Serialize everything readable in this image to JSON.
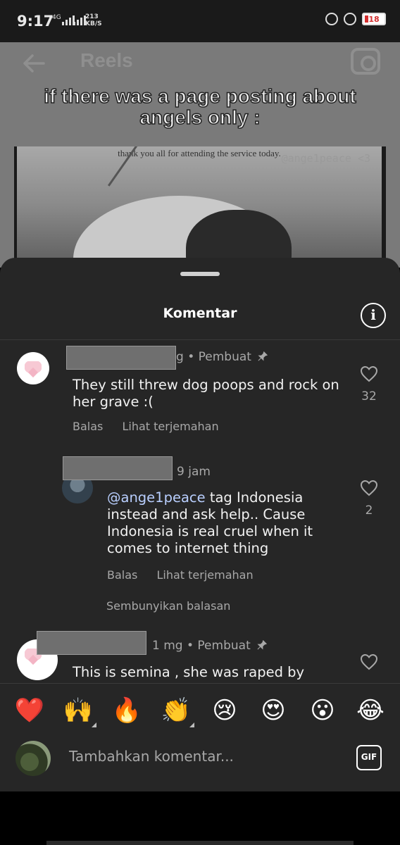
{
  "status_bar": {
    "time": "9:17",
    "network": "4G",
    "speed_value": "213",
    "speed_unit": "KB/S",
    "battery": "18"
  },
  "reel": {
    "title": "Reels",
    "caption": "if there was a page posting about angels only :",
    "image_text": "thank you all for attending the service today.",
    "watermark": "@ange1peace <3"
  },
  "sheet": {
    "title": "Komentar",
    "info_icon": "i"
  },
  "comments": [
    {
      "username_tail": "g",
      "meta_suffix": "• Pembuat",
      "text": "They still threw dog poops and rock on her grave :(",
      "reply_label": "Balas",
      "translate_label": "Lihat terjemahan",
      "likes": "32"
    },
    {
      "time": "9 jam",
      "mention": "@ange1peace",
      "text": " tag Indonesia instead and ask help.. Cause Indonesia is real cruel when it comes to internet thing",
      "reply_label": "Balas",
      "translate_label": "Lihat terjemahan",
      "likes": "2",
      "hide_replies_label": "Sembunyikan balasan"
    },
    {
      "time": "1 mg",
      "meta_suffix": "• Pembuat",
      "text": "This is semina , she was raped by"
    }
  ],
  "emojis": [
    "❤️",
    "🙌",
    "🔥",
    "👏",
    "😢",
    "😍",
    "😮",
    "😂"
  ],
  "input": {
    "placeholder": "Tambahkan komentar...",
    "gif_label": "GIF"
  },
  "colors": {
    "sheet_bg": "#262626",
    "mention": "#b9cfff",
    "secondary_text": "#a8a8a8",
    "heart_emoji": "#e0245e"
  }
}
